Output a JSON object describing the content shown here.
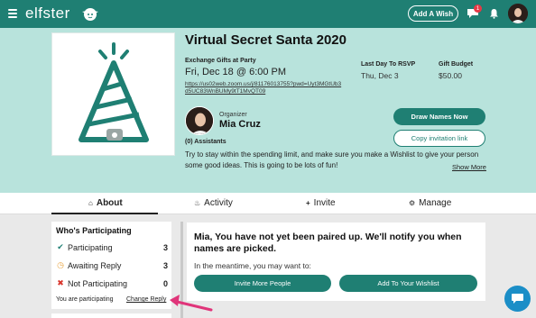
{
  "topbar": {
    "logo_text": "elfster",
    "add_wish_label": "Add A Wish",
    "notification_count": "1",
    "icons": [
      "hamburger-menu-icon",
      "elf-logo-icon",
      "chat-icon",
      "bell-icon",
      "avatar"
    ]
  },
  "event": {
    "title": "Virtual Secret Santa 2020",
    "exchange_label": "Exchange Gifts at Party",
    "date": "Fri, Dec 18 @ 6:00 PM",
    "zoom_link": "https://us02web.zoom.us/j/81176013755?pwd=Uyt3MGtUb3d5UC83WnBUMy9tT1MvQT09",
    "rsvp_label": "Last Day To RSVP",
    "rsvp_value": "Thu, Dec 3",
    "budget_label": "Gift Budget",
    "budget_value": "$50.00",
    "organizer_label": "Organizer",
    "organizer_name": "Mia Cruz",
    "assistants": "(0) Assistants",
    "description": "Try to stay within the spending limit, and make sure you make a Wishlist to give your person some good ideas. This is going to be lots of fun!",
    "show_more": "Show More",
    "draw_names_label": "Draw Names Now",
    "copy_link_label": "Copy invitation link"
  },
  "tabs": [
    {
      "label": "About",
      "icon": "home-icon",
      "active": true
    },
    {
      "label": "Activity",
      "icon": "bell-icon",
      "active": false
    },
    {
      "label": "Invite",
      "icon": "plus-icon",
      "active": false
    },
    {
      "label": "Manage",
      "icon": "gear-icon",
      "active": false
    }
  ],
  "participation": {
    "title": "Who's Participating",
    "rows": [
      {
        "label": "Participating",
        "count": "3",
        "icon": "check-icon",
        "color": "#1f7f73"
      },
      {
        "label": "Awaiting Reply",
        "count": "3",
        "icon": "clock-icon",
        "color": "#e8a33d"
      },
      {
        "label": "Not Participating",
        "count": "0",
        "icon": "x-icon",
        "color": "#d9342b"
      }
    ],
    "you_are": "You are participating",
    "change_reply": "Change Reply"
  },
  "pairing": {
    "message": "Mia, You have not yet been paired up. We'll notify you when names are picked.",
    "sub": "In the meantime, you may want to:",
    "invite_more_label": "Invite More People",
    "add_wishlist_label": "Add To Your Wishlist"
  },
  "colors": {
    "brand": "#1f7f73",
    "header_bg": "#b8e3dc",
    "annotation_arrow": "#e0357a",
    "chat_fab": "#1b8ec7"
  }
}
